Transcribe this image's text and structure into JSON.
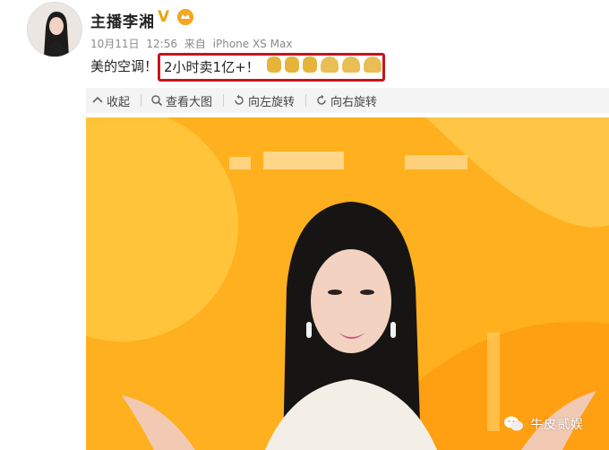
{
  "post": {
    "user_name": "主播李湘",
    "verified_mark": "V",
    "date": "10月11日",
    "time": "12:56",
    "source_prefix": "来自",
    "device": "iPhone XS Max",
    "text_prefix": "美的空调！",
    "highlight_text": "2小时卖1亿+！",
    "emoji": [
      "victory-hand",
      "victory-hand",
      "victory-hand",
      "clapping-hands",
      "clapping-hands",
      "clapping-hands"
    ]
  },
  "toolbar": {
    "collect_label": "收起",
    "view_large_label": "查看大图",
    "rotate_left_label": "向左旋转",
    "rotate_right_label": "向右旋转"
  },
  "watermark": {
    "text": "牛皮贰娱"
  },
  "colors": {
    "highlight_border": "#c8141e",
    "image_background": "#ffb01e",
    "verified": "#e8a50c"
  }
}
